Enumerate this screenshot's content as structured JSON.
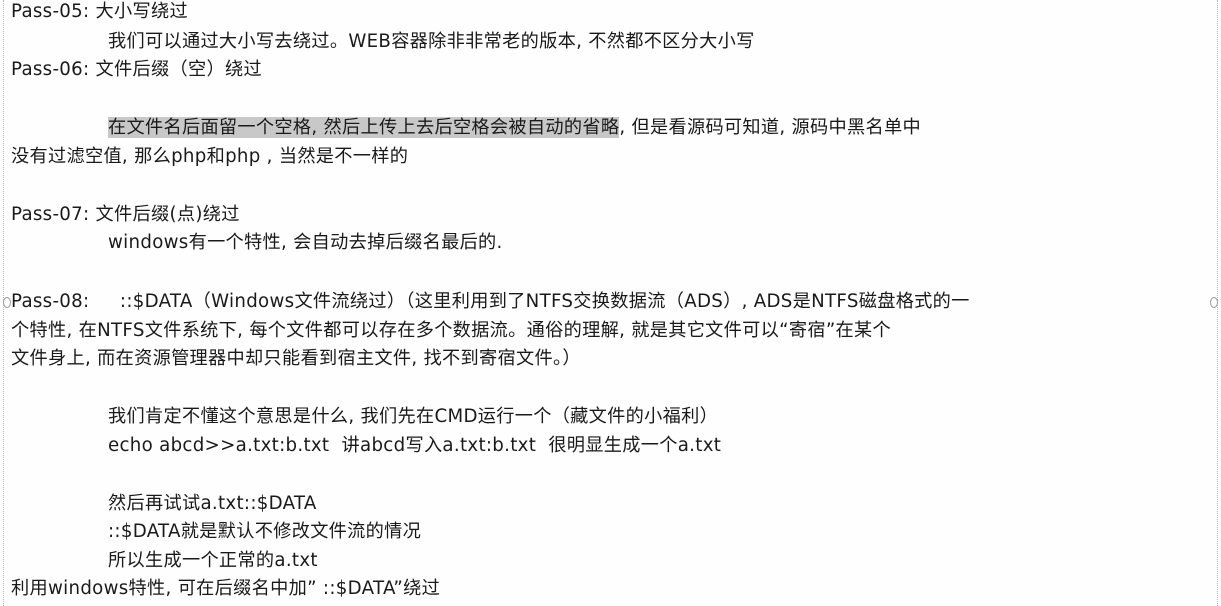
{
  "lines": {
    "l1": "Pass-05: 大小写绕过",
    "l2": "我们可以通过大小写去绕过。WEB容器除非非常老的版本, 不然都不区分大小写",
    "l3": "Pass-06: 文件后缀（空）绕过",
    "l4_highlight": "在文件名后面留一个空格, 然后上传上去后空格会被自动的省略",
    "l4_rest": ", 但是看源码可知道, 源码中黑名单中",
    "l5": "没有过滤空值, 那么php和php , 当然是不一样的",
    "l6": "Pass-07: 文件后缀(点)绕过",
    "l7": "windows有一个特性, 会自动去掉后缀名最后的.",
    "l8": "Pass-08:     ::$DATA（Windows文件流绕过）（这里利用到了NTFS交换数据流（ADS）, ADS是NTFS磁盘格式的一",
    "l9": "个特性, 在NTFS文件系统下, 每个文件都可以存在多个数据流。通俗的理解, 就是其它文件可以“寄宿”在某个",
    "l10": "文件身上, 而在资源管理器中却只能看到宿主文件, 找不到寄宿文件。）",
    "l11": "我们肯定不懂这个意思是什么, 我们先在CMD运行一个（藏文件的小福利）",
    "l12": "echo abcd>>a.txt:b.txt  讲abcd写入a.txt:b.txt  很明显生成一个a.txt",
    "l13": "然后再试试a.txt::$DATA",
    "l14": "::$DATA就是默认不修改文件流的情况",
    "l15": "所以生成一个正常的a.txt",
    "l16": "利用windows特性, 可在后缀名中加” ::$DATA”绕过"
  }
}
